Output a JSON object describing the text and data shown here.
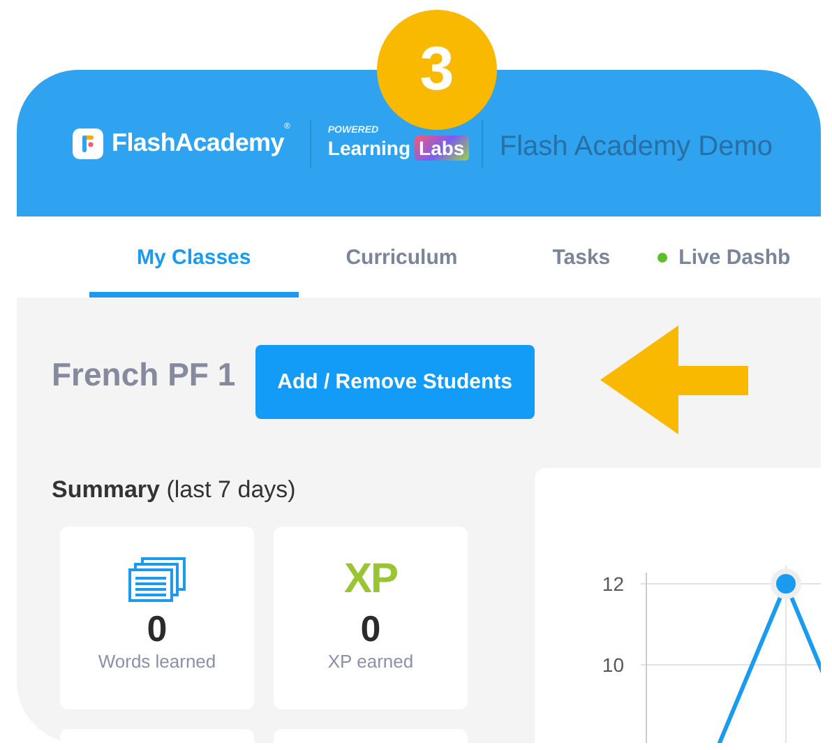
{
  "step_badge": "3",
  "header": {
    "logo": "FlashAcademy",
    "logo_mark": "®",
    "partner_caption": "POWERED",
    "partner_name": "Learning",
    "partner_name_tag": "Labs",
    "school": "Flash Academy Demo"
  },
  "tabs": [
    {
      "label": "My Classes",
      "selected": true,
      "live": false
    },
    {
      "label": "Curriculum",
      "selected": false,
      "live": false
    },
    {
      "label": "Tasks",
      "selected": false,
      "live": false
    },
    {
      "label": "Live Dashb",
      "selected": false,
      "live": true
    }
  ],
  "class_title": "French PF 1",
  "add_remove_button": "Add / Remove Students",
  "summary": {
    "title": "Summary",
    "period": "(last 7 days)"
  },
  "stats": [
    {
      "kind": "words",
      "value": "0",
      "label": "Words learned"
    },
    {
      "kind": "xp",
      "value": "0",
      "label": "XP earned",
      "icon_text": "XP"
    }
  ],
  "chart": {
    "y_tick_labels": [
      "12",
      "10"
    ]
  }
}
